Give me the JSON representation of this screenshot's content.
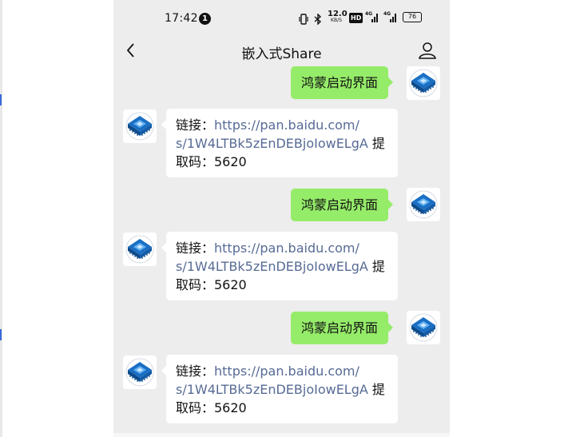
{
  "status_bar": {
    "time": "17:42",
    "notification_count": "1",
    "network_speed_value": "12.0",
    "network_speed_unit": "KB/S",
    "hd_label": "HD",
    "signal_1_label": "4G",
    "signal_2_label": "4G",
    "battery": "76",
    "icons": [
      "vibrate-icon",
      "bluetooth-icon",
      "hd-icon",
      "signal-icon",
      "signal-icon",
      "battery-icon"
    ]
  },
  "header": {
    "title": "嵌入式Share",
    "back_icon": "chevron-left-icon",
    "profile_icon": "person-icon"
  },
  "messages": [
    {
      "direction": "out",
      "text": "鸿蒙启动界面"
    },
    {
      "direction": "in",
      "prefix": "链接：",
      "link_line1": "https://pan.baidu.com/",
      "link_line2": "s/1W4LTBk5zEnDEBjoIowELgA",
      "suffix_line2": " 提",
      "line3": "取码：5620"
    },
    {
      "direction": "out",
      "text": "鸿蒙启动界面"
    },
    {
      "direction": "in",
      "prefix": "链接：",
      "link_line1": "https://pan.baidu.com/",
      "link_line2": "s/1W4LTBk5zEnDEBjoIowELgA",
      "suffix_line2": " 提",
      "line3": "取码：5620"
    },
    {
      "direction": "out",
      "text": "鸿蒙启动界面"
    },
    {
      "direction": "in",
      "prefix": "链接：",
      "link_line1": "https://pan.baidu.com/",
      "link_line2": "s/1W4LTBk5zEnDEBjoIowELgA",
      "suffix_line2": " 提",
      "line3": "取码：5620"
    }
  ],
  "colors": {
    "chat_background": "#ededed",
    "outgoing_bubble": "#95ec69",
    "incoming_bubble": "#ffffff",
    "link": "#576b95",
    "avatar_chip": "#1a6fc4"
  }
}
